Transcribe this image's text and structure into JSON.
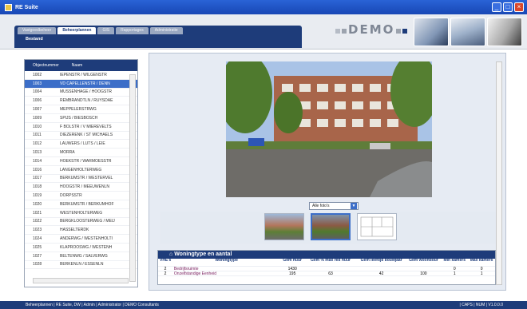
{
  "window": {
    "title": "RE Suite"
  },
  "tabs": [
    "Vastgoedbeheer",
    "Beheerplannen",
    "GIS",
    "Rapportages",
    "Administratie"
  ],
  "subnav": "Bestand",
  "brand": "DEMO",
  "list": {
    "headers": {
      "number": "Objectnummer",
      "name": "Naam"
    },
    "rows": [
      {
        "n": "1002",
        "name": "IEPENSTR / WILGENSTR"
      },
      {
        "n": "1003",
        "name": "VD CAPELLENSTR / DENN"
      },
      {
        "n": "1004",
        "name": "MUSSENHAGE / HOOGSTR"
      },
      {
        "n": "1006",
        "name": "REMBRANDTLN / RUYSDAE"
      },
      {
        "n": "1007",
        "name": "MEPPELERSTRWG"
      },
      {
        "n": "1009",
        "name": "SPIJS / BIESBOSCH"
      },
      {
        "n": "1010",
        "name": "F BOLSTR / V MIEREVELTS"
      },
      {
        "n": "1011",
        "name": "DIEZERENK / ST MICHAELS"
      },
      {
        "n": "1012",
        "name": "LAUWERS / LUTS / LEIE"
      },
      {
        "n": "1013",
        "name": "MORRA"
      },
      {
        "n": "1014",
        "name": "HOEKSTR / WARMOESSTR"
      },
      {
        "n": "1016",
        "name": "LANGENHOLTERWEG"
      },
      {
        "n": "1017",
        "name": "BERKUMSTR / WESTERVEL"
      },
      {
        "n": "1018",
        "name": "HOOGSTR / MEEUWENLN"
      },
      {
        "n": "1019",
        "name": "DORPSSTR"
      },
      {
        "n": "1020",
        "name": "BERKUMSTR / BERKUMHOF"
      },
      {
        "n": "1021",
        "name": "WESTENHOLTERWEG"
      },
      {
        "n": "1022",
        "name": "BERGKLOOSTERWEG / MEIJ"
      },
      {
        "n": "1023",
        "name": "HASSELTERDK"
      },
      {
        "n": "1024",
        "name": "ANDERWG / WESTENHOLTI"
      },
      {
        "n": "1025",
        "name": "KLAPROOSWG / WESTENH"
      },
      {
        "n": "1027",
        "name": "BELTENWG / SALVERWG"
      },
      {
        "n": "1028",
        "name": "BERKENLN / ESSENLN"
      }
    ],
    "selected_index": 1
  },
  "photo_select": "Alle foto's",
  "woningtype": {
    "title": "Woningtype en aantal",
    "headers": [
      "VHE's",
      "Woningtype",
      "Gem huur",
      "Gem % max red huur",
      "Gem leeftijd bouwjaar",
      "Gem woondour",
      "Min kamers",
      "Max kamers"
    ],
    "rows": [
      [
        "2",
        "Bedrijfsruimte",
        "1430",
        "",
        "",
        "",
        "0",
        "0"
      ],
      [
        "2",
        "Onzelfstandige Eenheid",
        "195",
        "63",
        "42",
        "100",
        "1",
        "1"
      ]
    ]
  },
  "status": {
    "left": "Beheerplannen | RE Suite, DW | Admin | Administrator | DEMO Consultants",
    "right": "| CAPS | NUM | V1.0.0.0"
  }
}
